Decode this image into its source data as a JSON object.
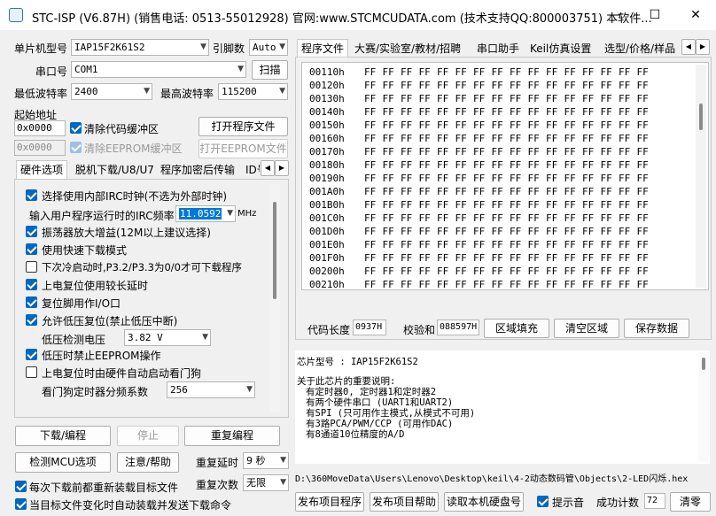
{
  "titlebar": {
    "title": "STC-ISP (V6.87H) (销售电话: 0513-55012928) 官网:www.STCMCUDATA.com  (技术支持QQ:800003751) 本软件...",
    "minimize": "—",
    "maximize": "☐",
    "close": "✕"
  },
  "left": {
    "mcu_label": "单片机型号",
    "mcu_value": "IAP15F2K61S2",
    "pin_label": "引脚数",
    "pin_value": "Auto",
    "port_label": "串口号",
    "port_value": "COM1",
    "scan_button": "扫描",
    "min_baud_label": "最低波特率",
    "min_baud_value": "2400",
    "max_baud_label": "最高波特率",
    "max_baud_value": "115200",
    "start_addr_label": "起始地址",
    "code_addr": "0x0000",
    "clear_code_label": "清除代码缓冲区",
    "open_prog_button": "打开程序文件",
    "eeprom_addr": "0x0000",
    "clear_eeprom_label": "清除EEPROM缓冲区",
    "open_eeprom_button": "打开EEPROM文件"
  },
  "left_tabs": [
    "硬件选项",
    "脱机下载/U8/U7",
    "程序加密后传输",
    "ID号"
  ],
  "hw": {
    "opt1": "选择使用内部IRC时钟(不选为外部时钟)",
    "freq_label": "输入用户程序运行时的IRC频率",
    "freq_value": "11.0592",
    "freq_unit": "MHz",
    "opt2": "振荡器放大增益(12M以上建议选择)",
    "opt3": "使用快速下载模式",
    "opt4": "下次冷启动时,P3.2/P3.3为0/0才可下载程序",
    "opt5": "上电复位使用较长延时",
    "opt6": "复位脚用作I/O口",
    "opt7": "允许低压复位(禁止低压中断)",
    "lv_label": "低压检测电压",
    "lv_value": "3.82 V",
    "opt8": "低压时禁止EEPROM操作",
    "opt9": "上电复位时由硬件自动启动看门狗",
    "wdt_label": "看门狗定时器分频系数",
    "wdt_value": "256"
  },
  "bottom_left": {
    "download": "下载/编程",
    "stop": "停止",
    "reprogram": "重复编程",
    "detect": "检测MCU选项",
    "help": "注意/帮助",
    "delay_label": "重复延时",
    "delay_value": "9 秒",
    "count_label": "重复次数",
    "count_value": "无限",
    "reload_label": "每次下载前都重新装载目标文件",
    "auto_label": "当目标文件变化时自动装载并发送下载命令"
  },
  "right_tabs": [
    "程序文件",
    "大赛/实验室/教材/招聘",
    "串口助手",
    "Keil仿真设置",
    "选型/价格/样品"
  ],
  "hex": {
    "rows": [
      "00110h",
      "00120h",
      "00130h",
      "00140h",
      "00150h",
      "00160h",
      "00170h",
      "00180h",
      "00190h",
      "001A0h",
      "001B0h",
      "001C0h",
      "001D0h",
      "001E0h",
      "001F0h",
      "00200h",
      "00210h"
    ],
    "byte": "FF"
  },
  "code_info": {
    "len_label": "代码长度",
    "len_value": "0937H",
    "sum_label": "校验和",
    "sum_value": "088597H",
    "fill_button": "区域填充",
    "clear_button": "清空区域",
    "save_button": "保存数据"
  },
  "info": {
    "chip_line": "芯片型号 : IAP15F2K61S2",
    "notes_title": "关于此芯片的重要说明:",
    "notes": [
      "有定时器0, 定时器1和定时器2",
      "有两个硬件串口 (UART1和UART2)",
      "有SPI (只可用作主模式,从模式不可用)",
      "有3路PCA/PWM/CCP (可用作DAC)",
      "有8通道10位精度的A/D"
    ]
  },
  "filepath": "D:\\360MoveData\\Users\\Lenovo\\Desktop\\keil\\4-2动态数码管\\Objects\\2-LED闪烁.hex",
  "bottom_right": {
    "publish_prog": "发布项目程序",
    "publish_help": "发布项目帮助",
    "read_disk": "读取本机硬盘号",
    "sound_label": "提示音",
    "success_label": "成功计数",
    "success_value": "72",
    "clear": "清零"
  },
  "colors": {
    "accent": "#0067c0",
    "selection": "#0078d7"
  }
}
